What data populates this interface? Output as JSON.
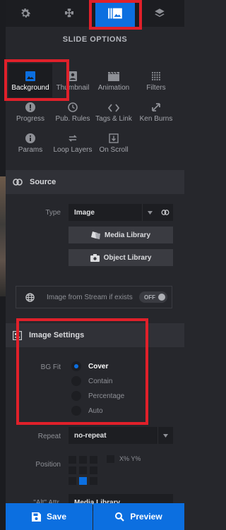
{
  "top_tabs": [
    {
      "icon": "gear-icon",
      "active": false
    },
    {
      "icon": "puzzle-icon",
      "active": false
    },
    {
      "icon": "slide-layers-icon",
      "active": true
    },
    {
      "icon": "layers-icon",
      "active": false
    }
  ],
  "panel_title": "SLIDE OPTIONS",
  "options": [
    {
      "label": "Background",
      "icon": "image-icon",
      "active": true
    },
    {
      "label": "Thumbnail",
      "icon": "portrait-icon",
      "active": false
    },
    {
      "label": "Animation",
      "icon": "clapper-icon",
      "active": false
    },
    {
      "label": "Filters",
      "icon": "dots-grid-icon",
      "active": false
    },
    {
      "label": "Progress",
      "icon": "alert-icon",
      "active": false
    },
    {
      "label": "Pub. Rules",
      "icon": "clock-icon",
      "active": false
    },
    {
      "label": "Tags & Link",
      "icon": "code-icon",
      "active": false
    },
    {
      "label": "Ken Burns",
      "icon": "ken-burns-icon",
      "active": false
    },
    {
      "label": "Params",
      "icon": "info-icon",
      "active": false
    },
    {
      "label": "Loop Layers",
      "icon": "loop-icon",
      "active": false
    },
    {
      "label": "On Scroll",
      "icon": "scroll-icon",
      "active": false
    }
  ],
  "source": {
    "title": "Source",
    "type_label": "Type",
    "type_value": "Image",
    "media_library": "Media Library",
    "object_library": "Object Library",
    "stream_label": "Image from Stream if exists",
    "stream_toggle": "OFF"
  },
  "image_settings": {
    "title": "Image Settings",
    "bgfit_label": "BG Fit",
    "bgfit_options": [
      "Cover",
      "Contain",
      "Percentage",
      "Auto"
    ],
    "bgfit_selected": "Cover",
    "repeat_label": "Repeat",
    "repeat_value": "no-repeat",
    "position_label": "Position",
    "position_selected": "bottom-center",
    "xy_label": "X% Y%",
    "alt_label": "\"Alt\" Attr.",
    "alt_value": "Media Library"
  },
  "footer": {
    "save_label": "Save",
    "preview_label": "Preview"
  },
  "colors": {
    "accent": "#0c6fe0",
    "highlight": "#e0202a",
    "panel_bg": "#26272c"
  }
}
